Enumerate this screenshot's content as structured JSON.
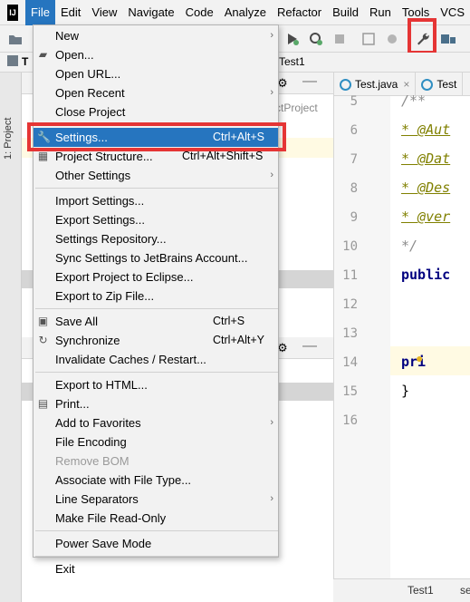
{
  "menubar": {
    "logo_text": "IJ",
    "items": [
      "File",
      "Edit",
      "View",
      "Navigate",
      "Code",
      "Analyze",
      "Refactor",
      "Build",
      "Run",
      "Tools",
      "VCS"
    ],
    "active": "File"
  },
  "breadcrumb": {
    "root_fragment": "T",
    "file_fragment": "Test1"
  },
  "project_panel": {
    "side_label": "1: Project",
    "path_fragment": "ctProject"
  },
  "editor": {
    "tabs": [
      "Test.java",
      "Test"
    ],
    "lines": [
      {
        "n": "5",
        "text": "/**",
        "kind": "com"
      },
      {
        "n": "6",
        "text": " * @Aut",
        "kind": "tag"
      },
      {
        "n": "7",
        "text": " * @Dat",
        "kind": "tag"
      },
      {
        "n": "8",
        "text": " * @Des",
        "kind": "tag"
      },
      {
        "n": "9",
        "text": " * @ver",
        "kind": "tag"
      },
      {
        "n": "10",
        "text": " */",
        "kind": "com"
      },
      {
        "n": "11",
        "text": "public",
        "kind": "kw"
      },
      {
        "n": "12",
        "text": "",
        "kind": "plain"
      },
      {
        "n": "13",
        "text": "",
        "kind": "plain"
      },
      {
        "n": "14",
        "text": "pri",
        "kind": "kw"
      },
      {
        "n": "15",
        "text": "}",
        "kind": "plain"
      },
      {
        "n": "16",
        "text": "",
        "kind": "plain"
      }
    ]
  },
  "status": {
    "left": "Test1",
    "right": "se"
  },
  "file_menu": {
    "items": [
      {
        "label": "New",
        "shortcut": "",
        "submenu": true,
        "icon": ""
      },
      {
        "label": "Open...",
        "shortcut": "",
        "submenu": false,
        "icon": "folder-icon"
      },
      {
        "label": "Open URL...",
        "shortcut": "",
        "submenu": false,
        "icon": ""
      },
      {
        "label": "Open Recent",
        "shortcut": "",
        "submenu": true,
        "icon": ""
      },
      {
        "label": "Close Project",
        "shortcut": "",
        "submenu": false,
        "icon": ""
      },
      {
        "sep": true
      },
      {
        "label": "Settings...",
        "shortcut": "Ctrl+Alt+S",
        "submenu": false,
        "icon": "wrench-icon",
        "selected": true
      },
      {
        "label": "Project Structure...",
        "shortcut": "Ctrl+Alt+Shift+S",
        "submenu": false,
        "icon": "project-structure-icon"
      },
      {
        "label": "Other Settings",
        "shortcut": "",
        "submenu": true,
        "icon": ""
      },
      {
        "sep": true
      },
      {
        "label": "Import Settings...",
        "shortcut": "",
        "submenu": false,
        "icon": ""
      },
      {
        "label": "Export Settings...",
        "shortcut": "",
        "submenu": false,
        "icon": ""
      },
      {
        "label": "Settings Repository...",
        "shortcut": "",
        "submenu": false,
        "icon": ""
      },
      {
        "label": "Sync Settings to JetBrains Account...",
        "shortcut": "",
        "submenu": false,
        "icon": ""
      },
      {
        "label": "Export Project to Eclipse...",
        "shortcut": "",
        "submenu": false,
        "icon": ""
      },
      {
        "label": "Export to Zip File...",
        "shortcut": "",
        "submenu": false,
        "icon": ""
      },
      {
        "sep": true
      },
      {
        "label": "Save All",
        "shortcut": "Ctrl+S",
        "submenu": false,
        "icon": "save-icon"
      },
      {
        "label": "Synchronize",
        "shortcut": "Ctrl+Alt+Y",
        "submenu": false,
        "icon": "sync-icon"
      },
      {
        "label": "Invalidate Caches / Restart...",
        "shortcut": "",
        "submenu": false,
        "icon": ""
      },
      {
        "sep": true
      },
      {
        "label": "Export to HTML...",
        "shortcut": "",
        "submenu": false,
        "icon": ""
      },
      {
        "label": "Print...",
        "shortcut": "",
        "submenu": false,
        "icon": "print-icon"
      },
      {
        "label": "Add to Favorites",
        "shortcut": "",
        "submenu": true,
        "icon": ""
      },
      {
        "label": "File Encoding",
        "shortcut": "",
        "submenu": false,
        "icon": ""
      },
      {
        "label": "Remove BOM",
        "shortcut": "",
        "submenu": false,
        "icon": "",
        "disabled": true
      },
      {
        "label": "Associate with File Type...",
        "shortcut": "",
        "submenu": false,
        "icon": ""
      },
      {
        "label": "Line Separators",
        "shortcut": "",
        "submenu": true,
        "icon": ""
      },
      {
        "label": "Make File Read-Only",
        "shortcut": "",
        "submenu": false,
        "icon": ""
      },
      {
        "sep": true
      },
      {
        "label": "Power Save Mode",
        "shortcut": "",
        "submenu": false,
        "icon": ""
      },
      {
        "sep": true
      },
      {
        "label": "Exit",
        "shortcut": "",
        "submenu": false,
        "icon": ""
      }
    ]
  },
  "colors": {
    "selection": "#2675bf",
    "highlight_box": "#e53535"
  }
}
